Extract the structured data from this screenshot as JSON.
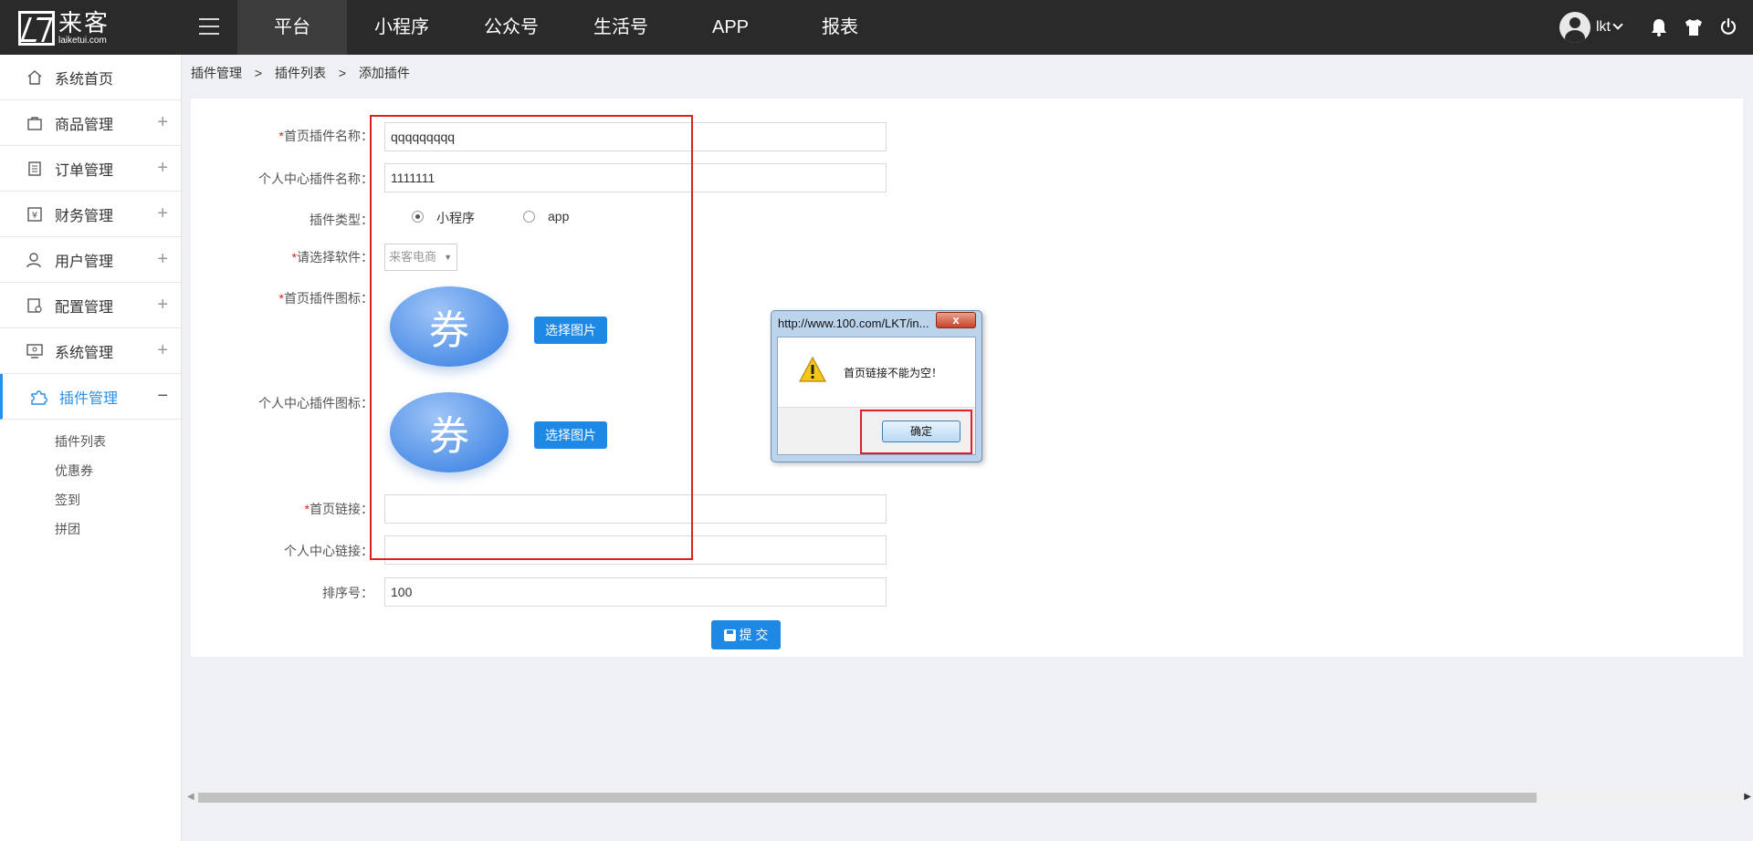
{
  "header": {
    "logo_name": "来客",
    "logo_domain": "laiketui.com",
    "nav": [
      "平台",
      "小程序",
      "公众号",
      "生活号",
      "APP",
      "报表"
    ],
    "active_nav": "平台",
    "username": "lkt",
    "icons": [
      "menu-icon",
      "avatar-icon",
      "bell-icon",
      "tshirt-icon",
      "power-icon"
    ]
  },
  "sidebar": {
    "items": [
      {
        "label": "系统首页",
        "icon": "home-icon"
      },
      {
        "label": "商品管理",
        "icon": "shopping-bag-icon",
        "expand": "+"
      },
      {
        "label": "订单管理",
        "icon": "order-list-icon",
        "expand": "+"
      },
      {
        "label": "财务管理",
        "icon": "finance-yen-icon",
        "expand": "+"
      },
      {
        "label": "用户管理",
        "icon": "user-icon",
        "expand": "+"
      },
      {
        "label": "配置管理",
        "icon": "config-icon",
        "expand": "+"
      },
      {
        "label": "系统管理",
        "icon": "monitor-icon",
        "expand": "+"
      },
      {
        "label": "插件管理",
        "icon": "puzzle-icon",
        "expand": "−"
      }
    ],
    "sub_items": [
      "插件列表",
      "优惠券",
      "签到",
      "拼团"
    ]
  },
  "breadcrumb": [
    "插件管理",
    ">",
    "插件列表",
    ">",
    "添加插件"
  ],
  "form": {
    "home_name_label": "首页插件名称：",
    "home_name_value": "qqqqqqqqq",
    "center_name_label": "个人中心插件名称：",
    "center_name_value": "1111111",
    "type_label": "插件类型：",
    "type_options": [
      "小程序",
      "app"
    ],
    "type_selected": "小程序",
    "software_label": "请选择软件：",
    "software_value": "来客电商",
    "home_icon_label": "首页插件图标：",
    "center_icon_label": "个人中心插件图标：",
    "coupon_glyph": "券",
    "choose_image": "选择图片",
    "home_link_label": "首页链接：",
    "home_link_value": "",
    "center_link_label": "个人中心链接：",
    "center_link_value": "",
    "sort_label": "排序号：",
    "sort_value": "100",
    "submit": "提 交",
    "required_mark": "*"
  },
  "dialog": {
    "title": "http://www.100.com/LKT/in...",
    "close": "x",
    "message": "首页链接不能为空！",
    "ok": "确定"
  },
  "colors": {
    "topbar": "#2a2a2a",
    "accent": "#1e88e5",
    "highlight": "#e02020"
  }
}
